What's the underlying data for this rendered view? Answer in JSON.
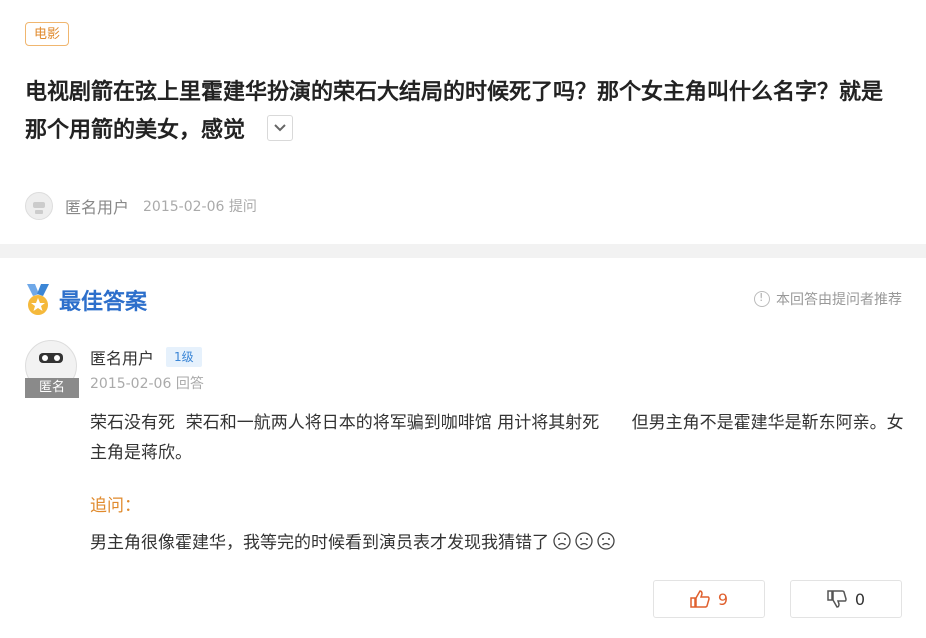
{
  "category_tag": "电影",
  "question": {
    "title": "电视剧箭在弦上里霍建华扮演的荣石大结局的时候死了吗？那个女主角叫什么名字？就是那个用箭的美女，感觉",
    "asker_name": "匿名用户",
    "asked_date": "2015-02-06",
    "asked_label": "提问"
  },
  "best_answer": {
    "title": "最佳答案",
    "recommend_note": "本回答由提问者推荐",
    "avatar_badge": "匿名",
    "author_name": "匿名用户",
    "author_level": "1级",
    "answer_date": "2015-02-06",
    "answer_label": "回答",
    "content": "荣石没有死  荣石和一航两人将日本的将军骗到咖啡馆 用计将其射死      但男主角不是霍建华是靳东阿亲。女主角是蒋欣。",
    "followup_label": "追问：",
    "followup_text": "男主角很像霍建华，我等完的时候看到演员表才发现我猜错了"
  },
  "votes": {
    "up_count": "9",
    "down_count": "0"
  },
  "colors": {
    "accent_blue": "#2d6fcb",
    "accent_orange": "#e08a2c",
    "upvote": "#e0602e"
  },
  "icons": {
    "expand": "chevron-down-icon",
    "medal": "medal-icon",
    "info": "info-icon",
    "upvote": "thumb-up-icon",
    "downvote": "thumb-down-icon",
    "emoji": "sad-face-icon"
  }
}
